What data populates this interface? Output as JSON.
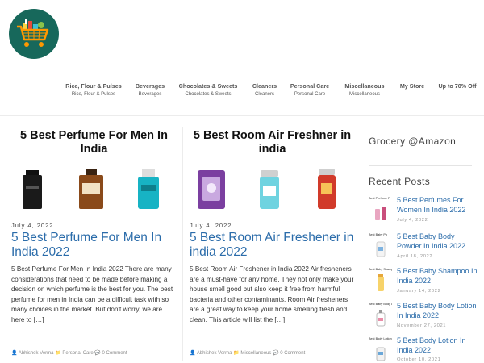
{
  "nav": [
    {
      "label": "Rice, Flour & Pulses",
      "sub": "Rice, Flour & Pulses"
    },
    {
      "label": "Beverages",
      "sub": "Beverages"
    },
    {
      "label": "Chocolates & Sweets",
      "sub": "Chocolates & Sweets"
    },
    {
      "label": "Cleaners",
      "sub": "Cleaners"
    },
    {
      "label": "Personal Care",
      "sub": "Personal Care"
    },
    {
      "label": "Miscellaneous",
      "sub": "Miscellaneous"
    },
    {
      "label": "My Store",
      "sub": ""
    },
    {
      "label": "Up to 70% Off",
      "sub": ""
    }
  ],
  "posts": [
    {
      "thumb_title": "5 Best Perfume For Men In India",
      "date": "July 4, 2022",
      "title": "5 Best Perfume For Men In India 2022",
      "excerpt": "5 Best Perfume For Men In India 2022 There are many considerations that need to be made before making a decision on which perfume is the best for you. The best perfume for men in India can be a difficult task with so many choices in the market. But don't worry, we are here to […]",
      "author": "Abhishek Verma",
      "category": "Personal Care",
      "comments": "0 Comment"
    },
    {
      "thumb_title": "5 Best Room Air Freshner in india",
      "date": "July 4, 2022",
      "title": "5 Best Room Air Freshener in india 2022",
      "excerpt": "5 Best Room Air Freshener in India 2022 Air fresheners are a must-have for any home. They not only make your house smell good but also keep it free from harmful bacteria and other contaminants. Room Air fresheners are a great way to keep your home smelling fresh and clean. This article will list the […]",
      "author": "Abhishek Verma",
      "category": "Miscellaneous",
      "comments": "0 Comment"
    }
  ],
  "sidebar": {
    "grocery_title": "Grocery @Amazon",
    "recent_title": "Recent Posts",
    "recent": [
      {
        "thumb_text": "Best Perfume F",
        "title": "5 Best Perfumes For Women In India 2022",
        "date": "July 4, 2022"
      },
      {
        "thumb_text": "Best Baby Po",
        "title": "5 Best Baby Body Powder In India 2022",
        "date": "April 18, 2022"
      },
      {
        "thumb_text": "Best Baby Shampo",
        "title": "5 Best Baby Shampoo In India 2022",
        "date": "January 14, 2022"
      },
      {
        "thumb_text": "Best Baby Body Lo",
        "title": "5 Best Baby Body Lotion In India 2022",
        "date": "November 27, 2021"
      },
      {
        "thumb_text": "Best Body Lotion In",
        "title": "5 Best Body Lotion In India 2022",
        "date": "October 10, 2021"
      }
    ]
  },
  "icons": {
    "author": "user-icon",
    "category": "folder-icon",
    "comments": "comment-icon"
  },
  "colors": {
    "link": "#2b6caa",
    "logo_bg": "#17685b",
    "cart": "#ff9800"
  }
}
